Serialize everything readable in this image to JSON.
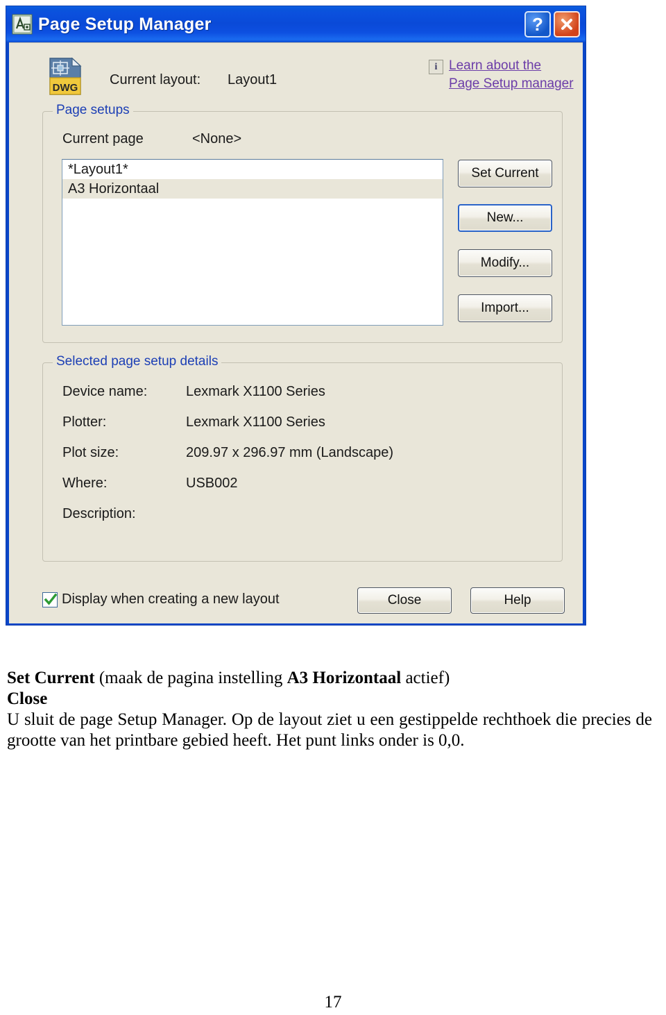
{
  "window": {
    "title": "Page Setup Manager",
    "icon": "autocad-icon",
    "help_button": "?",
    "close_button": "X"
  },
  "header": {
    "layout_label": "Current layout:",
    "layout_value": "Layout1",
    "document_icon": "dwg-file-icon",
    "info_icon": "i",
    "learn_link_line1": "Learn about the",
    "learn_link_line2": "Page Setup manager"
  },
  "page_setups": {
    "group_title": "Page setups",
    "current_page_label": "Current page",
    "current_page_value": "<None>",
    "items": [
      {
        "label": "*Layout1*",
        "selected": false
      },
      {
        "label": "A3 Horizontaal",
        "selected": true
      }
    ],
    "buttons": {
      "set_current": "Set Current",
      "new": "New...",
      "modify": "Modify...",
      "import": "Import..."
    }
  },
  "details": {
    "group_title": "Selected page setup details",
    "rows": [
      {
        "label": "Device name:",
        "value": "Lexmark X1100 Series"
      },
      {
        "label": "Plotter:",
        "value": "Lexmark X1100 Series"
      },
      {
        "label": "Plot size:",
        "value": "209.97 x 296.97 mm (Landscape)"
      },
      {
        "label": "Where:",
        "value": "USB002"
      },
      {
        "label": "Description:",
        "value": ""
      }
    ]
  },
  "footer": {
    "checkbox_label": "Display when creating a new layout",
    "checkbox_checked": true,
    "close_button": "Close",
    "help_button": "Help"
  },
  "document": {
    "line1_bold": "Set Current",
    "line1_rest_a": " (maak de pagina instelling ",
    "line1_bold_b": "A3 Horizontaal",
    "line1_rest_b": " actief)",
    "line2_bold": "Close",
    "paragraph": "U sluit de page Setup Manager. Op de layout ziet u een gestippelde rechthoek die precies de grootte van het printbare gebied heeft. Het punt links onder is 0,0.",
    "page_number": "17"
  },
  "colors": {
    "titlebar_blue": "#0a4ad8",
    "dialog_face": "#e9e6d9",
    "group_label_blue": "#1c3fb5",
    "link_purple": "#6b3ca8",
    "selection_beige": "#e9e6d9",
    "check_green": "#2d9b34"
  }
}
